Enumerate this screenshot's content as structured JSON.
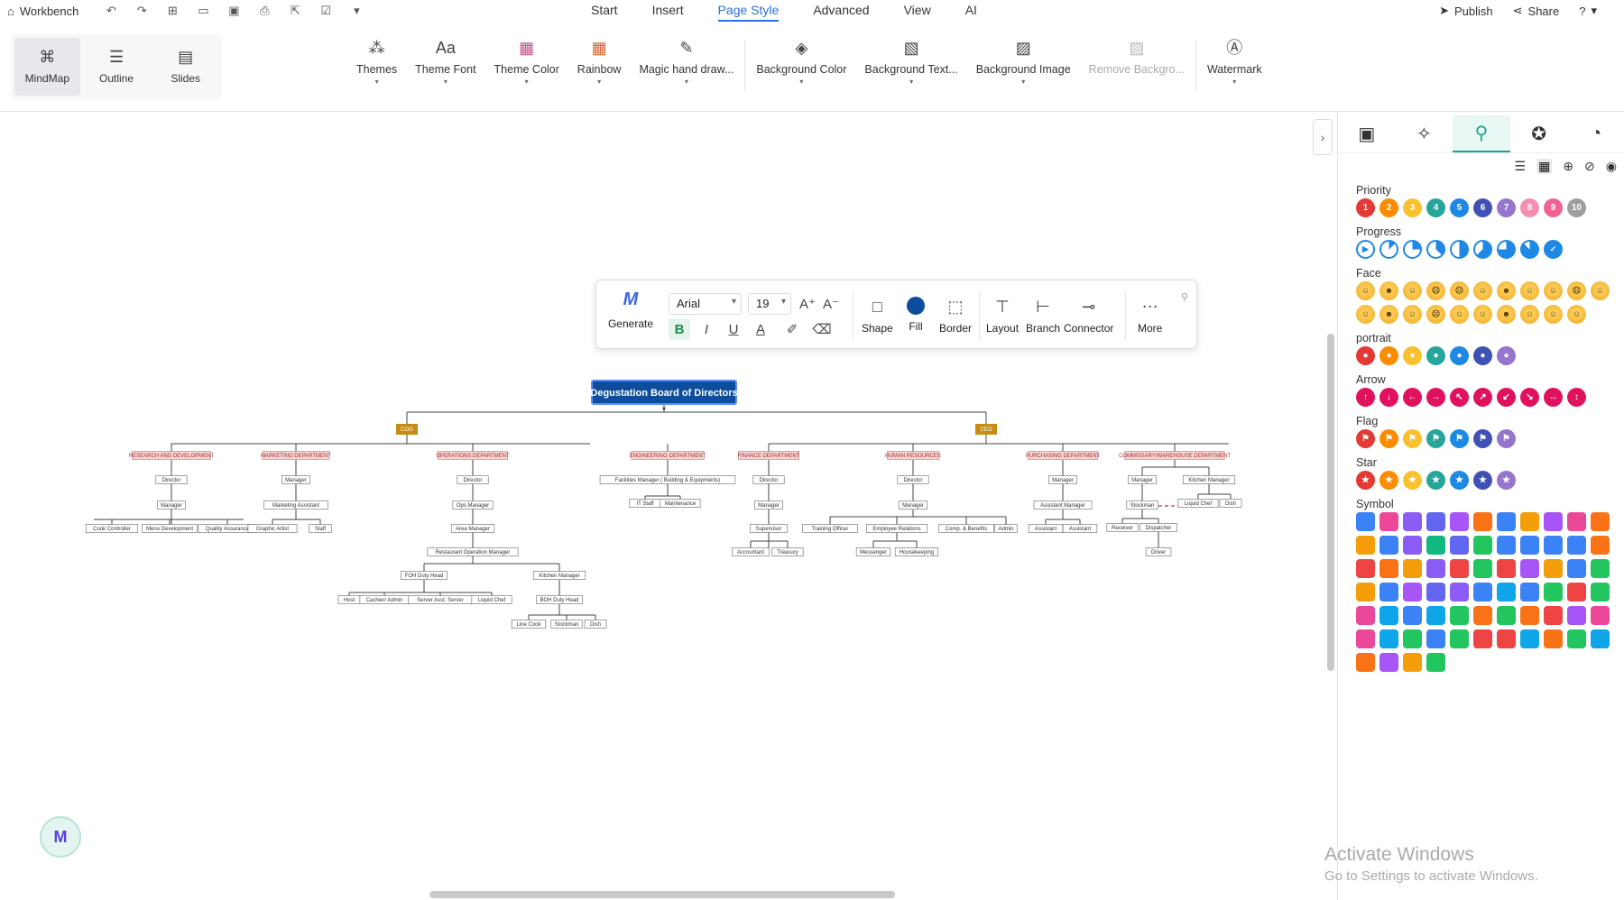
{
  "topbar": {
    "workbench": "Workbench",
    "menu": [
      "Start",
      "Insert",
      "Page Style",
      "Advanced",
      "View",
      "AI"
    ],
    "active_menu": "Page Style",
    "publish": "Publish",
    "share": "Share"
  },
  "view_modes": [
    "MindMap",
    "Outline",
    "Slides"
  ],
  "ribbon": {
    "themes": "Themes",
    "theme_font": "Theme Font",
    "theme_color": "Theme Color",
    "rainbow": "Rainbow",
    "magic": "Magic hand draw...",
    "bg_color": "Background Color",
    "bg_texture": "Background Text...",
    "bg_image": "Background Image",
    "remove_bg": "Remove Backgro...",
    "watermark": "Watermark"
  },
  "format_bar": {
    "generate": "Generate",
    "font": "Arial",
    "size": "19",
    "shape": "Shape",
    "fill": "Fill",
    "border": "Border",
    "layout": "Layout",
    "branch": "Branch",
    "connector": "Connector",
    "more": "More",
    "fill_color": "#0d4d9c"
  },
  "mindmap": {
    "root": "Degustation Board of Directors",
    "coo": "COO",
    "ceo": "CEO",
    "departments": {
      "rnd": "RESEARCH AND DEVELOPMENT",
      "mkt": "MARKETING DEPARTMENT",
      "ops": "OPERATIONS DEPARTMENT",
      "eng": "ENGINEERING DEPARTMENT",
      "fin": "FINANCE DEPARTMENT",
      "hr": "HUMAN RESOURCES",
      "pur": "PURCHASING DEPARTMENT",
      "com": "COMMISSARY/WAREHOUSE DEPARTMENT"
    },
    "nodes": {
      "rnd_director": "Director",
      "rnd_manager": "Manager",
      "rnd_c1": "Cook Controller",
      "rnd_c2": "Menu Development",
      "rnd_c3": "Quality Assurance",
      "mkt_manager": "Manager",
      "mkt_asst": "Marketing Assistant",
      "mkt_c1": "Graphic Artist",
      "mkt_c2": "Staff",
      "ops_director": "Director",
      "ops_mgr": "Ops Manager",
      "ops_area": "Area Manager",
      "ops_rom": "Restaurant Operation Manager",
      "ops_foh": "FOH Duty Head",
      "ops_kitchen": "Kitchen Manager",
      "ops_f1": "Host",
      "ops_f2": "Cashier/ Admin",
      "ops_f3": "Server Asst. Server",
      "ops_f4": "Liquid Chef",
      "ops_boh": "BOH Duty Head",
      "ops_b1": "Line Cook",
      "ops_b2": "Stockman",
      "ops_b3": "Dish",
      "eng_fm": "Facilities Manager ( Building & Equipments)",
      "eng_it": "IT Staff",
      "eng_mt": "Maintenance",
      "fin_director": "Director",
      "fin_manager": "Manager",
      "fin_sup": "Supervisor",
      "fin_acc": "Accountant",
      "fin_tre": "Treasury",
      "hr_director": "Director",
      "hr_manager": "Manager",
      "hr_c1": "Training Officer",
      "hr_c2": "Employee Relations",
      "hr_c3": "Comp. & Benefits",
      "hr_c4": "Admin",
      "hr_m1": "Messenger",
      "hr_m2": "Housekeeping",
      "pur_manager": "Manager",
      "pur_asst_mgr": "Assistant Manager",
      "pur_a1": "Assistant",
      "pur_a2": "Assistant",
      "com_manager": "Manager",
      "com_kitchen": "Kitchen Manager",
      "com_stock": "Stockman",
      "com_liquid": "Liquid Chef",
      "com_dish": "Dish",
      "com_receiver": "Receiver",
      "com_dispatcher": "Dispatcher",
      "com_driver": "Driver"
    }
  },
  "panel": {
    "groups": {
      "priority": "Priority",
      "progress": "Progress",
      "face": "Face",
      "portrait": "portrait",
      "arrow": "Arrow",
      "flag": "Flag",
      "star": "Star",
      "symbol": "Symbol"
    },
    "priority_values": [
      "1",
      "2",
      "3",
      "4",
      "5",
      "6",
      "7",
      "8",
      "9",
      "10"
    ],
    "colors": [
      "#e53935",
      "#fb8c00",
      "#fbc02d",
      "#26a69a",
      "#1e88e5",
      "#3f51b5",
      "#9575cd",
      "#f48fb1",
      "#f06292",
      "#9e9e9e"
    ]
  },
  "watermark": {
    "line1": "Activate Windows",
    "line2": "Go to Settings to activate Windows."
  }
}
